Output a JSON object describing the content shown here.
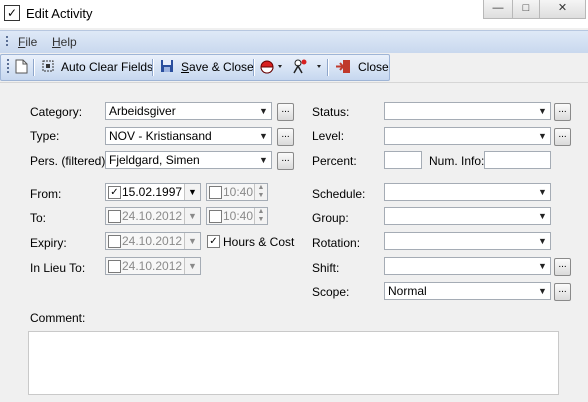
{
  "window": {
    "title": "Edit Activity",
    "controls": {
      "minimize": "—",
      "maximize": "□",
      "close": "✕"
    }
  },
  "menu": [
    {
      "label": "File",
      "underline": "F",
      "rest": "ile"
    },
    {
      "label": "Help",
      "underline": "H",
      "rest": "elp"
    }
  ],
  "toolbar": {
    "auto_clear": "Auto Clear Fields",
    "save_close": "Save & Close",
    "close": "Close"
  },
  "form": {
    "category": {
      "label": "Category:",
      "value": "Arbeidsgiver"
    },
    "type": {
      "label": "Type:",
      "value": "NOV - Kristiansand"
    },
    "pers": {
      "label": "Pers. (filtered):",
      "value": "Fjeldgard, Simen"
    },
    "from": {
      "label": "From:",
      "date": "15.02.1997",
      "time": "10:40",
      "date_checked": true,
      "time_checked": false
    },
    "to": {
      "label": "To:",
      "date": "24.10.2012",
      "time": "10:40",
      "date_checked": false,
      "time_checked": false
    },
    "expiry": {
      "label": "Expiry:",
      "date": "24.10.2012",
      "date_checked": false
    },
    "hours_cost": {
      "label": "Hours & Cost",
      "checked": true
    },
    "in_lieu_to": {
      "label": "In Lieu To:",
      "date": "24.10.2012",
      "date_checked": false
    },
    "status": {
      "label": "Status:",
      "value": ""
    },
    "level": {
      "label": "Level:",
      "value": ""
    },
    "percent": {
      "label": "Percent:",
      "value": ""
    },
    "num_info": {
      "label": "Num. Info:",
      "value": ""
    },
    "schedule": {
      "label": "Schedule:",
      "value": ""
    },
    "group": {
      "label": "Group:",
      "value": ""
    },
    "rotation": {
      "label": "Rotation:",
      "value": ""
    },
    "shift": {
      "label": "Shift:",
      "value": ""
    },
    "scope": {
      "label": "Scope:",
      "value": "Normal"
    },
    "comment": {
      "label": "Comment:",
      "value": ""
    }
  },
  "icons": [
    "new-document-icon",
    "auto-clear-icon",
    "save-disk-icon",
    "color-picker-icon",
    "activity-tool-icon",
    "exit-door-icon"
  ],
  "colors": {
    "toolbar_blue": "#c6d7ef",
    "menu_blue": "#c9d8ee",
    "window_bg": "#f0f0f0"
  }
}
